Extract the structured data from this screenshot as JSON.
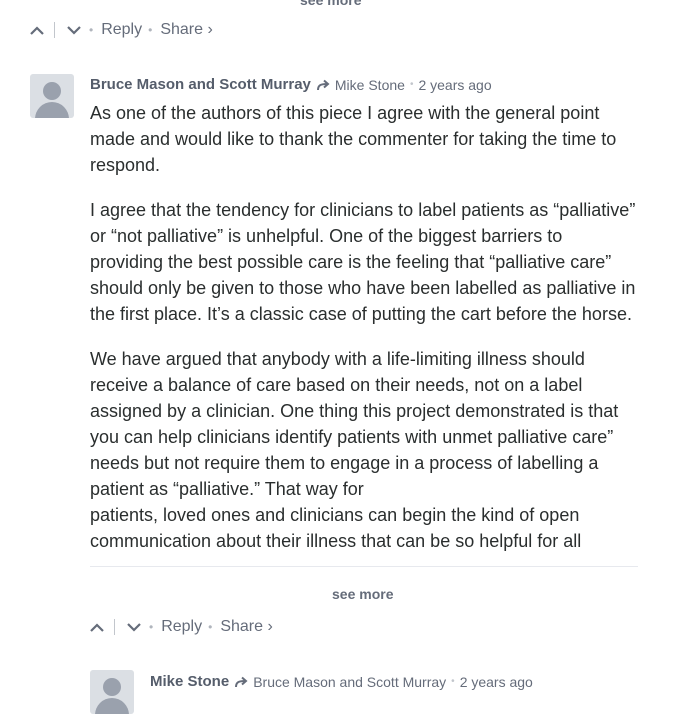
{
  "top": {
    "see_more_label": "see more"
  },
  "actions_top": {
    "reply": "Reply",
    "share": "Share ›"
  },
  "comment": {
    "author": "Bruce Mason and Scott Murray",
    "reply_to": "Mike Stone",
    "time": "2 years ago",
    "paragraphs": [
      "As one of the authors of this piece I agree with the general point made and would like to thank the commenter for taking the time to respond.",
      "I agree that the tendency for clinicians to label patients as “palliative” or “not palliative” is unhelpful. One of the biggest barriers to providing the best possible care is the feeling that “palliative care” should only be given to those who have been labelled as palliative in the first place. It’s a classic case of putting the cart before the horse.",
      "We have argued that anybody with a life-limiting illness should receive a balance of care based on their needs, not on a label assigned by a clinician. One thing this project demonstrated is that you can help clinicians identify patients with unmet palliative care” needs but not require them to engage in a process of labelling a patient as “palliative.” That way for",
      "patients, loved ones and clinicians can begin the kind of open communication about their illness that can be so helpful for all"
    ],
    "see_more": "see more",
    "actions": {
      "reply": "Reply",
      "share": "Share ›"
    }
  },
  "next_comment": {
    "author": "Mike Stone",
    "reply_to": "Bruce Mason and Scott Murray",
    "time": "2 years ago"
  }
}
